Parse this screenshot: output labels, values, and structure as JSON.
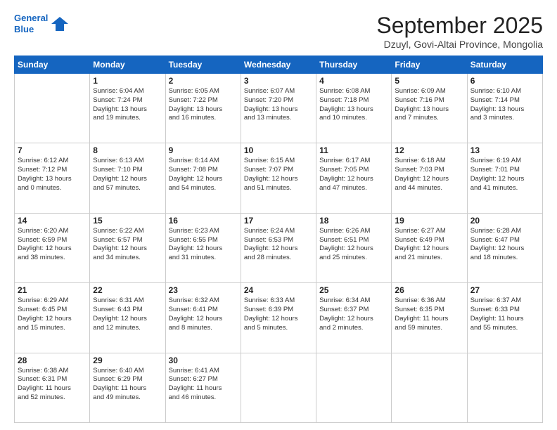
{
  "logo": {
    "line1": "General",
    "line2": "Blue"
  },
  "title": "September 2025",
  "location": "Dzuyl, Govi-Altai Province, Mongolia",
  "days_of_week": [
    "Sunday",
    "Monday",
    "Tuesday",
    "Wednesday",
    "Thursday",
    "Friday",
    "Saturday"
  ],
  "weeks": [
    [
      {
        "day": "",
        "info": ""
      },
      {
        "day": "1",
        "info": "Sunrise: 6:04 AM\nSunset: 7:24 PM\nDaylight: 13 hours\nand 19 minutes."
      },
      {
        "day": "2",
        "info": "Sunrise: 6:05 AM\nSunset: 7:22 PM\nDaylight: 13 hours\nand 16 minutes."
      },
      {
        "day": "3",
        "info": "Sunrise: 6:07 AM\nSunset: 7:20 PM\nDaylight: 13 hours\nand 13 minutes."
      },
      {
        "day": "4",
        "info": "Sunrise: 6:08 AM\nSunset: 7:18 PM\nDaylight: 13 hours\nand 10 minutes."
      },
      {
        "day": "5",
        "info": "Sunrise: 6:09 AM\nSunset: 7:16 PM\nDaylight: 13 hours\nand 7 minutes."
      },
      {
        "day": "6",
        "info": "Sunrise: 6:10 AM\nSunset: 7:14 PM\nDaylight: 13 hours\nand 3 minutes."
      }
    ],
    [
      {
        "day": "7",
        "info": "Sunrise: 6:12 AM\nSunset: 7:12 PM\nDaylight: 13 hours\nand 0 minutes."
      },
      {
        "day": "8",
        "info": "Sunrise: 6:13 AM\nSunset: 7:10 PM\nDaylight: 12 hours\nand 57 minutes."
      },
      {
        "day": "9",
        "info": "Sunrise: 6:14 AM\nSunset: 7:08 PM\nDaylight: 12 hours\nand 54 minutes."
      },
      {
        "day": "10",
        "info": "Sunrise: 6:15 AM\nSunset: 7:07 PM\nDaylight: 12 hours\nand 51 minutes."
      },
      {
        "day": "11",
        "info": "Sunrise: 6:17 AM\nSunset: 7:05 PM\nDaylight: 12 hours\nand 47 minutes."
      },
      {
        "day": "12",
        "info": "Sunrise: 6:18 AM\nSunset: 7:03 PM\nDaylight: 12 hours\nand 44 minutes."
      },
      {
        "day": "13",
        "info": "Sunrise: 6:19 AM\nSunset: 7:01 PM\nDaylight: 12 hours\nand 41 minutes."
      }
    ],
    [
      {
        "day": "14",
        "info": "Sunrise: 6:20 AM\nSunset: 6:59 PM\nDaylight: 12 hours\nand 38 minutes."
      },
      {
        "day": "15",
        "info": "Sunrise: 6:22 AM\nSunset: 6:57 PM\nDaylight: 12 hours\nand 34 minutes."
      },
      {
        "day": "16",
        "info": "Sunrise: 6:23 AM\nSunset: 6:55 PM\nDaylight: 12 hours\nand 31 minutes."
      },
      {
        "day": "17",
        "info": "Sunrise: 6:24 AM\nSunset: 6:53 PM\nDaylight: 12 hours\nand 28 minutes."
      },
      {
        "day": "18",
        "info": "Sunrise: 6:26 AM\nSunset: 6:51 PM\nDaylight: 12 hours\nand 25 minutes."
      },
      {
        "day": "19",
        "info": "Sunrise: 6:27 AM\nSunset: 6:49 PM\nDaylight: 12 hours\nand 21 minutes."
      },
      {
        "day": "20",
        "info": "Sunrise: 6:28 AM\nSunset: 6:47 PM\nDaylight: 12 hours\nand 18 minutes."
      }
    ],
    [
      {
        "day": "21",
        "info": "Sunrise: 6:29 AM\nSunset: 6:45 PM\nDaylight: 12 hours\nand 15 minutes."
      },
      {
        "day": "22",
        "info": "Sunrise: 6:31 AM\nSunset: 6:43 PM\nDaylight: 12 hours\nand 12 minutes."
      },
      {
        "day": "23",
        "info": "Sunrise: 6:32 AM\nSunset: 6:41 PM\nDaylight: 12 hours\nand 8 minutes."
      },
      {
        "day": "24",
        "info": "Sunrise: 6:33 AM\nSunset: 6:39 PM\nDaylight: 12 hours\nand 5 minutes."
      },
      {
        "day": "25",
        "info": "Sunrise: 6:34 AM\nSunset: 6:37 PM\nDaylight: 12 hours\nand 2 minutes."
      },
      {
        "day": "26",
        "info": "Sunrise: 6:36 AM\nSunset: 6:35 PM\nDaylight: 11 hours\nand 59 minutes."
      },
      {
        "day": "27",
        "info": "Sunrise: 6:37 AM\nSunset: 6:33 PM\nDaylight: 11 hours\nand 55 minutes."
      }
    ],
    [
      {
        "day": "28",
        "info": "Sunrise: 6:38 AM\nSunset: 6:31 PM\nDaylight: 11 hours\nand 52 minutes."
      },
      {
        "day": "29",
        "info": "Sunrise: 6:40 AM\nSunset: 6:29 PM\nDaylight: 11 hours\nand 49 minutes."
      },
      {
        "day": "30",
        "info": "Sunrise: 6:41 AM\nSunset: 6:27 PM\nDaylight: 11 hours\nand 46 minutes."
      },
      {
        "day": "",
        "info": ""
      },
      {
        "day": "",
        "info": ""
      },
      {
        "day": "",
        "info": ""
      },
      {
        "day": "",
        "info": ""
      }
    ]
  ]
}
